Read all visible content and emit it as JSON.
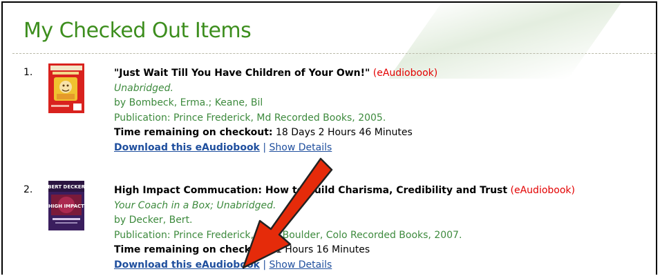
{
  "page": {
    "title": "My Checked Out Items"
  },
  "items": [
    {
      "number": "1.",
      "title": "\"Just Wait Till You Have Children of Your Own!\"",
      "format": "(eAudiobook)",
      "subtitle": "Unabridged.",
      "author": "by Bombeck, Erma.; Keane, Bil",
      "publication": "Publication: Prince Frederick, Md Recorded Books, 2005.",
      "time_label": "Time remaining on checkout:",
      "time_value": "18 Days 2 Hours 46 Minutes",
      "download_label": "Download this eAudiobook",
      "separator": "|",
      "details_label": "Show Details",
      "cover_icon": "book-cover-just-wait"
    },
    {
      "number": "2.",
      "title": "High Impact Commucation: How to Build Charisma, Credibility and Trust",
      "format": "(eAudiobook)",
      "subtitle": "Your Coach in a Box; Unabridged.",
      "author": "by Decker, Bert.",
      "publication": "Publication: Prince Frederick, MD, [Boulder, Colo Recorded Books, 2007.",
      "time_label": "Time remaining on checkout:",
      "time_value": "1 Hours 16 Minutes",
      "download_label": "Download this eAudiobook",
      "separator": "|",
      "details_label": "Show Details",
      "cover_icon": "book-cover-high-impact",
      "cover_text_top": "BERT DECKER",
      "cover_text_main": "HIGH IMPACT"
    }
  ],
  "annotation": {
    "icon": "red-arrow-icon",
    "color": "#e52b0a"
  },
  "colors": {
    "title_green": "#3d8e1e",
    "meta_green": "#3d8a3d",
    "link_blue": "#1f4f9e",
    "format_red": "#e30000"
  }
}
